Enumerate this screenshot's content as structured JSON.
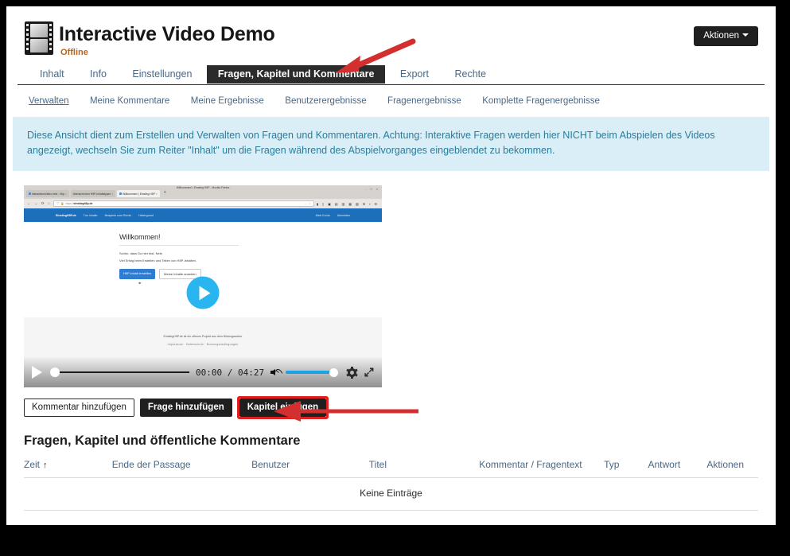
{
  "header": {
    "icon": "film-strip-icon",
    "title": "Interactive Video Demo",
    "status": "Offline",
    "actions_label": "Aktionen"
  },
  "tabs": [
    {
      "label": "Inhalt",
      "active": false
    },
    {
      "label": "Info",
      "active": false
    },
    {
      "label": "Einstellungen",
      "active": false
    },
    {
      "label": "Fragen, Kapitel und Kommentare",
      "active": true
    },
    {
      "label": "Export",
      "active": false
    },
    {
      "label": "Rechte",
      "active": false
    }
  ],
  "subtabs": [
    {
      "label": "Verwalten",
      "active": true
    },
    {
      "label": "Meine Kommentare",
      "active": false
    },
    {
      "label": "Meine Ergebnisse",
      "active": false
    },
    {
      "label": "Benutzerergebnisse",
      "active": false
    },
    {
      "label": "Fragenergebnisse",
      "active": false
    },
    {
      "label": "Komplette Fragenergebnisse",
      "active": false
    }
  ],
  "info_banner": {
    "text": "Diese Ansicht dient zum Erstellen und Verwalten von Fragen und Kommentaren. Achtung: Interaktive Fragen werden hier NICHT beim Abspielen des Videos angezeigt, wechseln Sie zum Reiter \"Inhalt\" um die Fragen während des Abspielvorganges eingeblendet zu bekommen.",
    "bg_color": "#d9eef6",
    "text_color": "#2b7d9c"
  },
  "player": {
    "current_time": "00:00",
    "duration": "04:27",
    "time_label": "00:00 / 04:27",
    "play_icon": "play-icon",
    "volume_icon": "volume-icon",
    "settings_icon": "gear-icon",
    "fullscreen_icon": "fullscreen-icon",
    "progress_percent": 0,
    "volume_percent": 100,
    "accent_color": "#1ba3e8",
    "thumbnail": {
      "window_title": "Willkommen! | Einstieg H5P - Mozilla Firefox",
      "browser_tabs": [
        {
          "label": "interaktivesVideo.html - h5p",
          "selected": false
        },
        {
          "label": "Übersicht über H5P-Inhaltstypen",
          "selected": false
        },
        {
          "label": "Willkommen! | Einstieg H5P",
          "selected": true
        }
      ],
      "new_tab_label": "+",
      "url": "https://einstiegh5p.de",
      "nav_menu": [
        "EinstiegH5P.de",
        "Tue Inhalte",
        "Beispiele zum Remix",
        "Hintergrund"
      ],
      "nav_menu_right": [
        "Mein Konto",
        "Abmelden"
      ],
      "page_heading": "Willkommen!",
      "page_line1": "Schön, dass Du hier bist, Nele.",
      "page_line2": "Viel Erfolg beim Erstellen und Teilen von H5P-Inhalten.",
      "primary_button": "H5P-Inhalt erstellen",
      "secondary_button": "Meine Inhalte ansehen",
      "footer_line1": "EinstiegH5P.de ist ein offenes Projekt aus dem Bildungssektor",
      "footer_line2": "Impressum · Datenschutz · Nutzungsbedingungen"
    }
  },
  "action_buttons": [
    {
      "label": "Kommentar hinzufügen",
      "style": "light",
      "highlighted": false
    },
    {
      "label": "Frage hinzufügen",
      "style": "dark",
      "highlighted": false
    },
    {
      "label": "Kapitel einfügen",
      "style": "dark",
      "highlighted": true
    }
  ],
  "table": {
    "title": "Fragen, Kapitel und öffentliche Kommentare",
    "columns": [
      {
        "label": "Zeit",
        "sorted": true,
        "sort_dir": "asc",
        "sort_glyph": "↑"
      },
      {
        "label": "Ende der Passage",
        "sorted": false
      },
      {
        "label": "Benutzer",
        "sorted": false
      },
      {
        "label": "Titel",
        "sorted": false
      },
      {
        "label": "Kommentar / Fragentext",
        "sorted": false
      },
      {
        "label": "Typ",
        "sorted": false
      },
      {
        "label": "Antwort",
        "sorted": false
      },
      {
        "label": "Aktionen",
        "sorted": false
      }
    ],
    "rows": [],
    "empty_message": "Keine Einträge"
  },
  "annotations": [
    {
      "name": "arrow-to-active-tab",
      "color": "#d32f2f",
      "direction": "down-left"
    },
    {
      "name": "arrow-to-kapitel-button",
      "color": "#d32f2f",
      "direction": "left"
    }
  ],
  "theme": {
    "page_bg": "#000000",
    "card_bg": "#ffffff",
    "link_color": "#4a6785",
    "dark_ui": "#1f1f1f",
    "highlight_red": "#e02020"
  }
}
